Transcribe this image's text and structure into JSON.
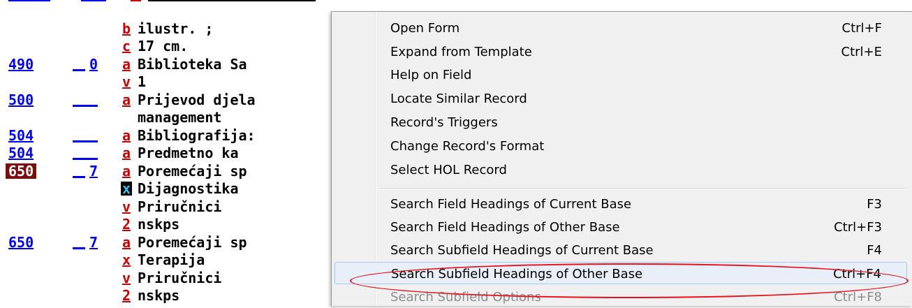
{
  "record": [
    {
      "tag": "",
      "ind": "",
      "sf": "",
      "value": "",
      "partial_top": true
    },
    {
      "tag": "",
      "ind": "",
      "sf": "b",
      "value": "ilustr. ;"
    },
    {
      "tag": "",
      "ind": "",
      "sf": "c",
      "value": "17 cm."
    },
    {
      "tag": "490",
      "ind": "0",
      "sf": "a",
      "value": "Biblioteka Sa"
    },
    {
      "tag": "",
      "ind": "",
      "sf": "v",
      "value": "1"
    },
    {
      "tag": "500",
      "ind": "",
      "sf": "a",
      "value": "Prijevod djela"
    },
    {
      "tag": "",
      "ind": "",
      "sf": "",
      "value": "management"
    },
    {
      "tag": "504",
      "ind": "",
      "sf": "a",
      "value": "Bibliografija:"
    },
    {
      "tag": "504",
      "ind": "",
      "sf": "a",
      "value": "Predmetno ka"
    },
    {
      "tag": "650",
      "ind": "7",
      "sf": "a",
      "value": "Poremećaji sp",
      "selected": true
    },
    {
      "tag": "",
      "ind": "",
      "sf": "x",
      "value": "Dijagnostika",
      "current": true
    },
    {
      "tag": "",
      "ind": "",
      "sf": "v",
      "value": "Priručnici"
    },
    {
      "tag": "",
      "ind": "",
      "sf": "2",
      "value": "nskps"
    },
    {
      "tag": "650",
      "ind": "7",
      "sf": "a",
      "value": "Poremećaji sp"
    },
    {
      "tag": "",
      "ind": "",
      "sf": "x",
      "value": "Terapija"
    },
    {
      "tag": "",
      "ind": "",
      "sf": "v",
      "value": "Priručnici"
    },
    {
      "tag": "",
      "ind": "",
      "sf": "2",
      "value": "nskps"
    }
  ],
  "menu": {
    "group1": [
      {
        "label": "Open Form",
        "shortcut": "Ctrl+F"
      },
      {
        "label": "Expand from Template",
        "shortcut": "Ctrl+E"
      },
      {
        "label": "Help on Field",
        "shortcut": ""
      },
      {
        "label": "Locate Similar Record",
        "shortcut": ""
      },
      {
        "label": "Record's Triggers",
        "shortcut": ""
      },
      {
        "label": "Change Record's Format",
        "shortcut": ""
      },
      {
        "label": "Select HOL Record",
        "shortcut": ""
      }
    ],
    "group2": [
      {
        "label": "Search Field Headings of Current Base",
        "shortcut": "F3"
      },
      {
        "label": "Search Field Headings of Other Base",
        "shortcut": "Ctrl+F3"
      },
      {
        "label": "Search Subfield Headings of Current Base",
        "shortcut": "F4"
      },
      {
        "label": "Search Subfield Headings of Other Base",
        "shortcut": "Ctrl+F4",
        "highlighted": true
      },
      {
        "label": "Search Subfield Options",
        "shortcut": "Ctrl+F8",
        "disabled": true
      }
    ]
  },
  "colors": {
    "tag_link": "#0000ee",
    "subfield_code": "#cc0000",
    "selected_tag_bg": "#7a0d0d",
    "annotation_ellipse": "#e8101a"
  }
}
